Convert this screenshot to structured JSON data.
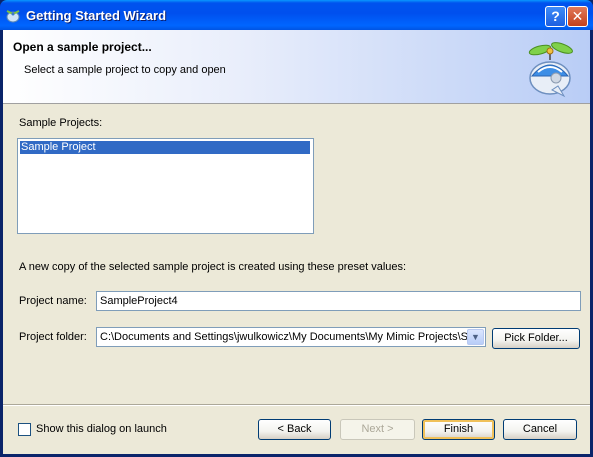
{
  "window": {
    "title": "Getting Started Wizard",
    "help_glyph": "?",
    "close_glyph": "✕"
  },
  "header": {
    "title": "Open a sample project...",
    "subtitle": "Select a sample project to copy and open",
    "logo_icon": "propeller-cap-icon"
  },
  "sample_projects": {
    "label": "Sample Projects:",
    "items": [
      {
        "label": "Sample Project",
        "selected": true
      }
    ]
  },
  "info_text": "A new copy of the selected sample project is created using these preset values:",
  "project_name": {
    "label": "Project name:",
    "value": "SampleProject4"
  },
  "project_folder": {
    "label": "Project folder:",
    "value": "C:\\Documents and Settings\\jwulkowicz\\My Documents\\My Mimic Projects\\Sar",
    "dropdown_glyph": "▼",
    "pick_label": "Pick Folder..."
  },
  "footer": {
    "checkbox_label": "Show this dialog on launch",
    "checkbox_checked": false,
    "back_label": "< Back",
    "next_label": "Next >",
    "finish_label": "Finish",
    "cancel_label": "Cancel"
  },
  "colors": {
    "title_bar": "#0054e3",
    "selection": "#316ac5",
    "dialog_bg": "#ece9d8"
  }
}
